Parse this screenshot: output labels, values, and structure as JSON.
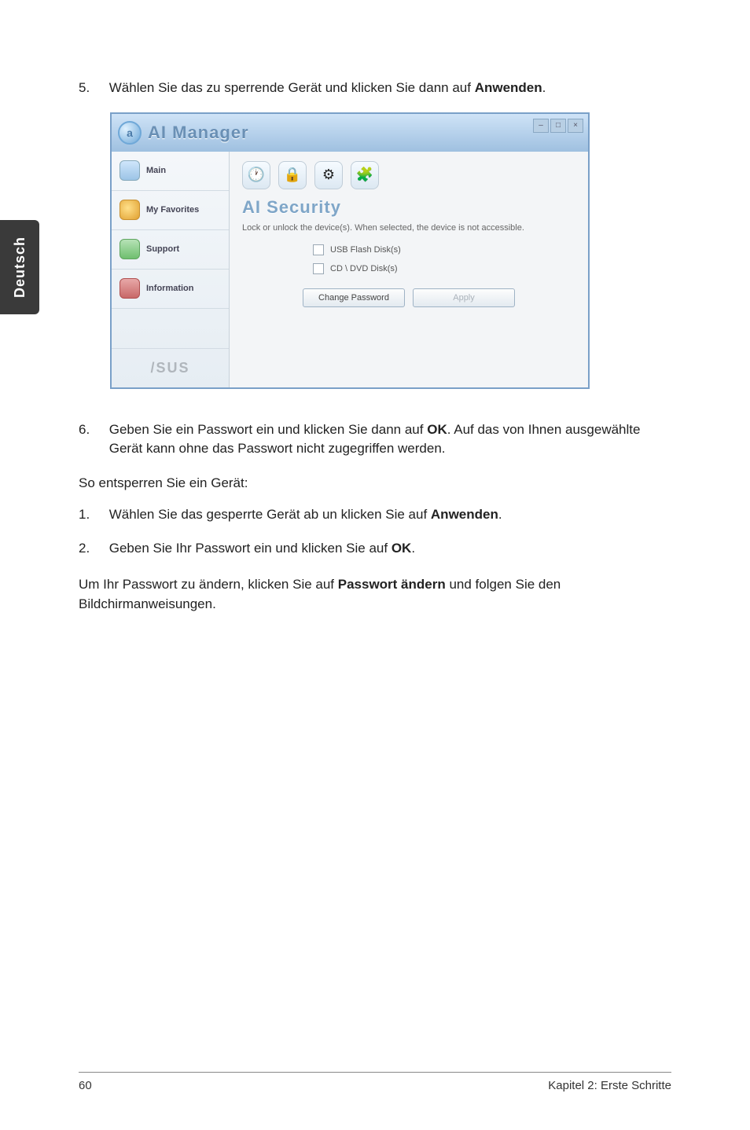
{
  "sideTab": "Deutsch",
  "step5": {
    "num": "5.",
    "text_pre": "Wählen Sie das zu sperrende Gerät und klicken Sie dann auf ",
    "bold": "Anwenden",
    "text_post": "."
  },
  "app": {
    "title": "AI Manager",
    "logoLetter": "a",
    "winbtns": [
      "–",
      "□",
      "×"
    ],
    "nav": [
      {
        "label": "Main"
      },
      {
        "label": "My Favorites"
      },
      {
        "label": "Support"
      },
      {
        "label": "Information"
      }
    ],
    "brand": "/SUS",
    "toolbarIcons": [
      "🕐",
      "🔒",
      "⚙",
      "🧩"
    ],
    "sectionTitle": "AI Security",
    "sectionDesc": "Lock or unlock the device(s). When selected, the device is not accessible.",
    "checks": [
      {
        "label": "USB Flash Disk(s)"
      },
      {
        "label": "CD \\ DVD Disk(s)"
      }
    ],
    "buttons": {
      "changePassword": "Change Password",
      "apply": "Apply"
    }
  },
  "step6": {
    "num": "6.",
    "pre": "Geben Sie ein Passwort ein und klicken Sie dann auf ",
    "bold": "OK",
    "post": ". Auf das von Ihnen ausgewählte Gerät kann ohne das Passwort nicht zugegriffen werden."
  },
  "unlockHeading": "So entsperren Sie ein Gerät:",
  "unlockSteps": [
    {
      "num": "1.",
      "pre": "Wählen Sie das gesperrte Gerät ab un klicken Sie auf ",
      "bold": "Anwenden",
      "post": "."
    },
    {
      "num": "2.",
      "pre": "Geben Sie Ihr Passwort ein und klicken Sie auf ",
      "bold": "OK",
      "post": "."
    }
  ],
  "pwChange": {
    "pre": "Um Ihr Passwort zu ändern, klicken Sie auf ",
    "bold": "Passwort ändern",
    "post": " und folgen Sie den Bildchirmanweisungen."
  },
  "footer": {
    "page": "60",
    "chapter": "Kapitel 2: Erste Schritte"
  }
}
